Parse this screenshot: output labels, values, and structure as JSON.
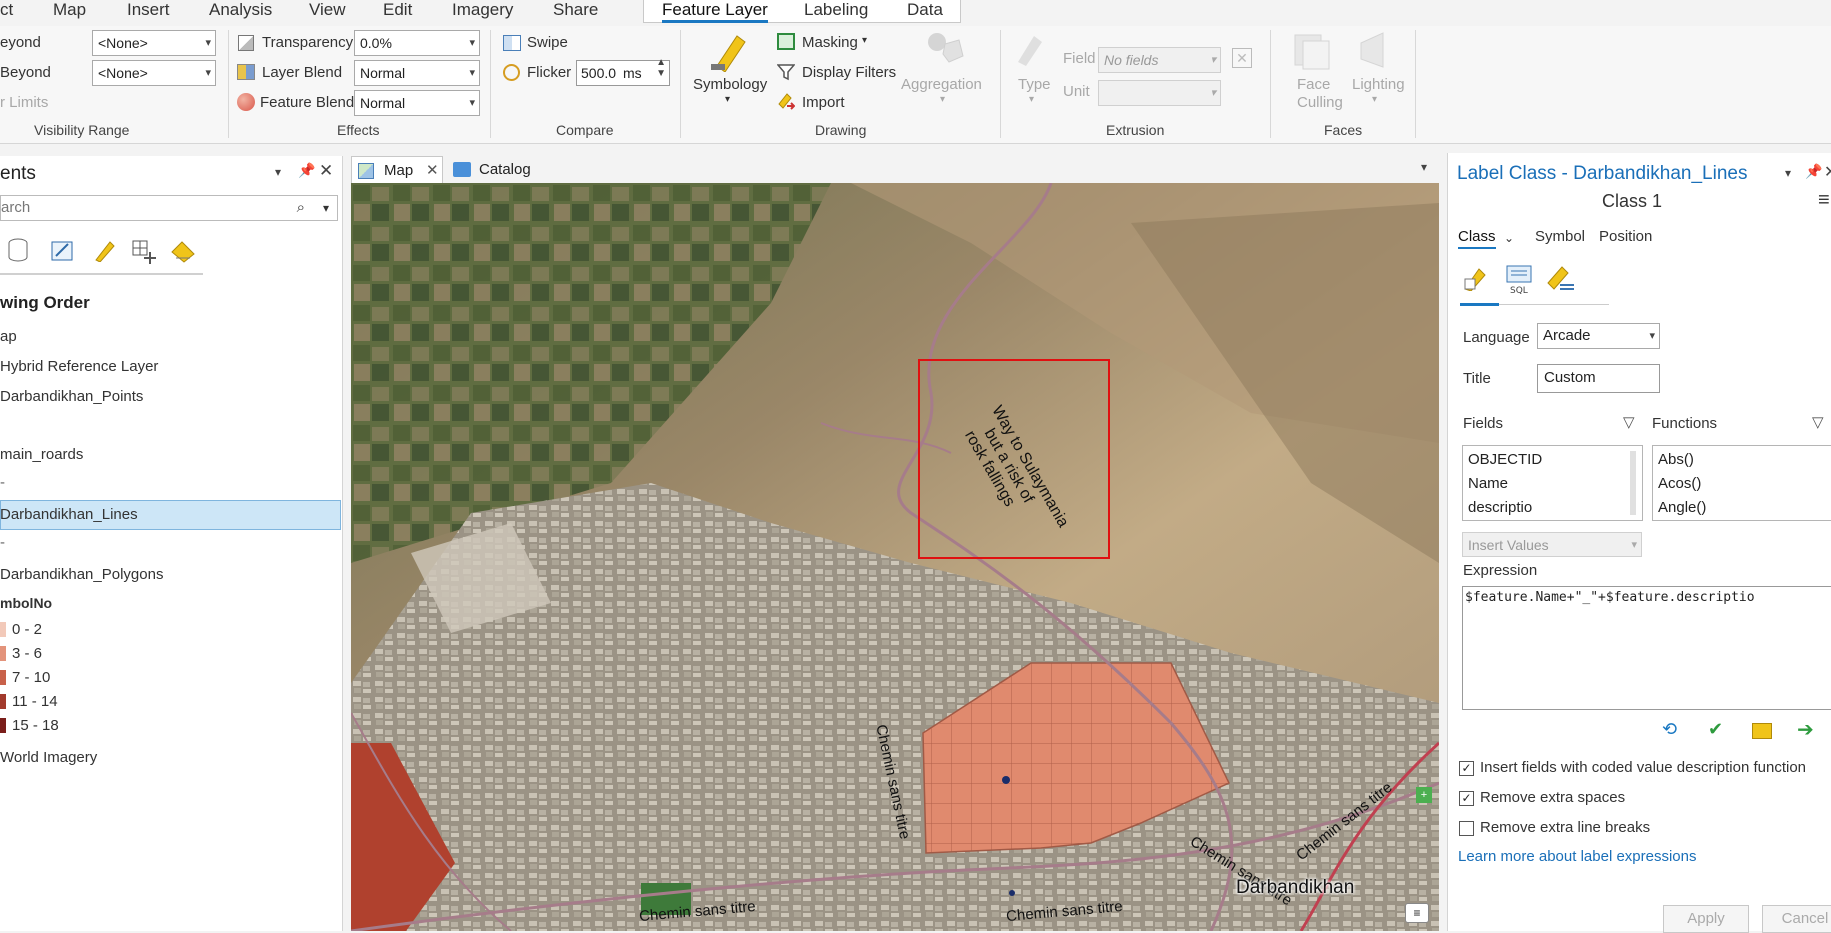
{
  "menu": [
    "ct",
    "Map",
    "Insert",
    "Analysis",
    "View",
    "Edit",
    "Imagery",
    "Share"
  ],
  "context_tabs": [
    "Feature Layer",
    "Labeling",
    "Data"
  ],
  "ribbon": {
    "visibility": {
      "beyond1": "eyond",
      "beyond2": "Beyond",
      "limits": "r Limits",
      "combo1": "<None>",
      "combo2": "<None>",
      "title": "Visibility Range"
    },
    "effects": {
      "transparency_label": "Transparency",
      "transparency_value": "0.0%",
      "layer_blend_label": "Layer Blend",
      "layer_blend_value": "Normal",
      "feature_blend_label": "Feature Blend",
      "feature_blend_value": "Normal",
      "title": "Effects"
    },
    "compare": {
      "swipe": "Swipe",
      "flicker": "Flicker",
      "flicker_value": "500.0",
      "flicker_unit": "ms",
      "title": "Compare"
    },
    "drawing": {
      "symbology": "Symbology",
      "masking": "Masking",
      "display_filters": "Display Filters",
      "import": "Import",
      "aggregation": "Aggregation",
      "title": "Drawing"
    },
    "extrusion": {
      "type": "Type",
      "field_label": "Field",
      "field_value": "No fields",
      "unit_label": "Unit",
      "title": "Extrusion"
    },
    "faces": {
      "face_culling": "Face Culling",
      "lighting": "Lighting",
      "title": "Faces"
    }
  },
  "contents": {
    "title": "ents",
    "search_placeholder": "arch",
    "drawing_order": "wing Order",
    "items": [
      "ap",
      "Hybrid Reference Layer",
      "Darbandikhan_Points",
      "main_roards",
      "Darbandikhan_Lines",
      "Darbandikhan_Polygons",
      "mbolNo",
      "World Imagery"
    ],
    "dash1": "-",
    "dash2": "-",
    "legend": [
      {
        "label": "0 - 2",
        "color": "#f2c9b9"
      },
      {
        "label": "3 - 6",
        "color": "#e3937b"
      },
      {
        "label": "7 - 10",
        "color": "#c8614a"
      },
      {
        "label": "11 - 14",
        "color": "#a23a2c"
      },
      {
        "label": "15 - 18",
        "color": "#7a1e1a"
      }
    ]
  },
  "map_tabs": {
    "map": "Map",
    "catalog": "Catalog"
  },
  "map": {
    "labels": {
      "way": "Way to Sulaymania",
      "way2": "but a risk of",
      "way3": "rosk fallings",
      "chemin": "Chemin sans titre",
      "town": "Darbandikhan"
    }
  },
  "label_class": {
    "title": "Label Class - Darbandikhan_Lines",
    "class_name": "Class 1",
    "tabs": [
      "Class",
      "Symbol",
      "Position"
    ],
    "language_label": "Language",
    "language_value": "Arcade",
    "title_label": "Title",
    "title_value": "Custom",
    "fields_label": "Fields",
    "functions_label": "Functions",
    "fields": [
      "OBJECTID",
      "Name",
      "descriptio"
    ],
    "functions": [
      "Abs()",
      "Acos()",
      "Angle()"
    ],
    "insert_values": "Insert Values",
    "expression_label": "Expression",
    "expression": "$feature.Name+\"_\"+$feature.descriptio",
    "opt1": "Insert fields with coded value description function",
    "opt2": "Remove extra spaces",
    "opt3": "Remove extra line breaks",
    "learn_more": "Learn more about label expressions",
    "apply": "Apply",
    "cancel": "Cancel"
  },
  "colors": {
    "accent": "#1a78c2",
    "selected": "#cde6f7",
    "polygon": "#e08a6e",
    "box": "#e01010"
  }
}
